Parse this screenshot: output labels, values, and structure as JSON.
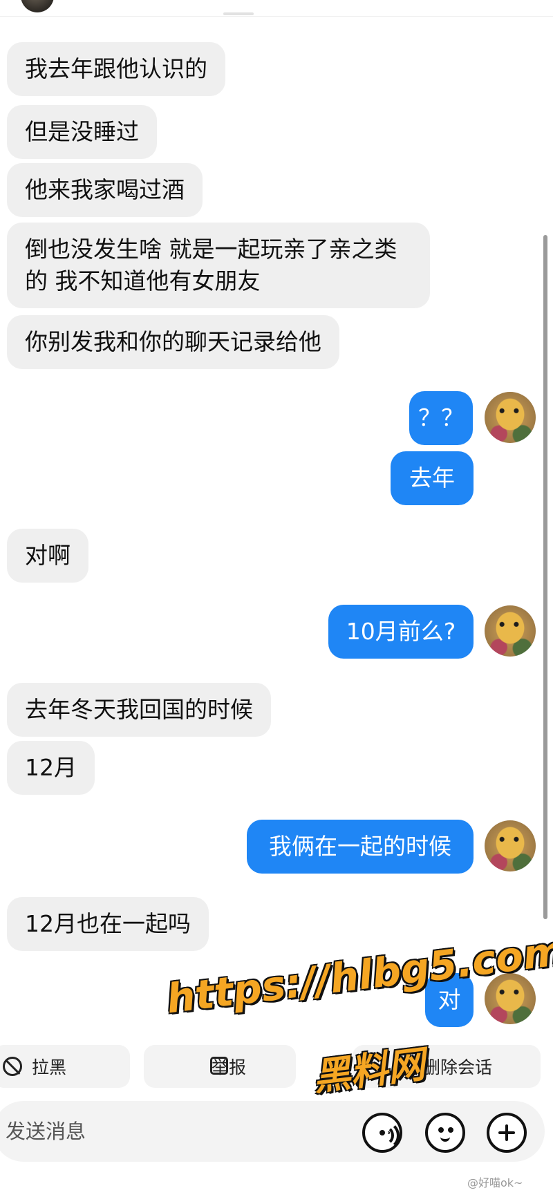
{
  "messages": [
    {
      "side": "in",
      "text": "我去年跟他认识的"
    },
    {
      "side": "in",
      "text": "但是没睡过"
    },
    {
      "side": "in",
      "text": "他来我家喝过酒"
    },
    {
      "side": "in",
      "text": "倒也没发生啥 就是一起玩亲了亲之类的 我不知道他有女朋友"
    },
    {
      "side": "in",
      "text": "你别发我和你的聊天记录给他"
    },
    {
      "side": "out",
      "text": "？？"
    },
    {
      "side": "out",
      "text": "去年"
    },
    {
      "side": "in",
      "text": "对啊"
    },
    {
      "side": "out",
      "text": "10月前么?"
    },
    {
      "side": "in",
      "text": "去年冬天我回国的时候"
    },
    {
      "side": "in",
      "text": "12月"
    },
    {
      "side": "out",
      "text": "我俩在一起的时候"
    },
    {
      "side": "in",
      "text": "12月也在一起吗"
    },
    {
      "side": "out",
      "text": "对"
    }
  ],
  "actions": {
    "block": "拉黑",
    "report": "举报",
    "delete": "删除会话"
  },
  "composer": {
    "placeholder": "发送消息",
    "icons": [
      "voice-icon",
      "emoji-icon",
      "plus-icon"
    ]
  },
  "watermark": {
    "url": "https://hlbg5.com",
    "name": "黑料网"
  },
  "credit": "@好喵ok~",
  "colors": {
    "outgoing_bubble": "#1f86f5",
    "incoming_bubble": "#efefef",
    "watermark": "#f5a623"
  }
}
